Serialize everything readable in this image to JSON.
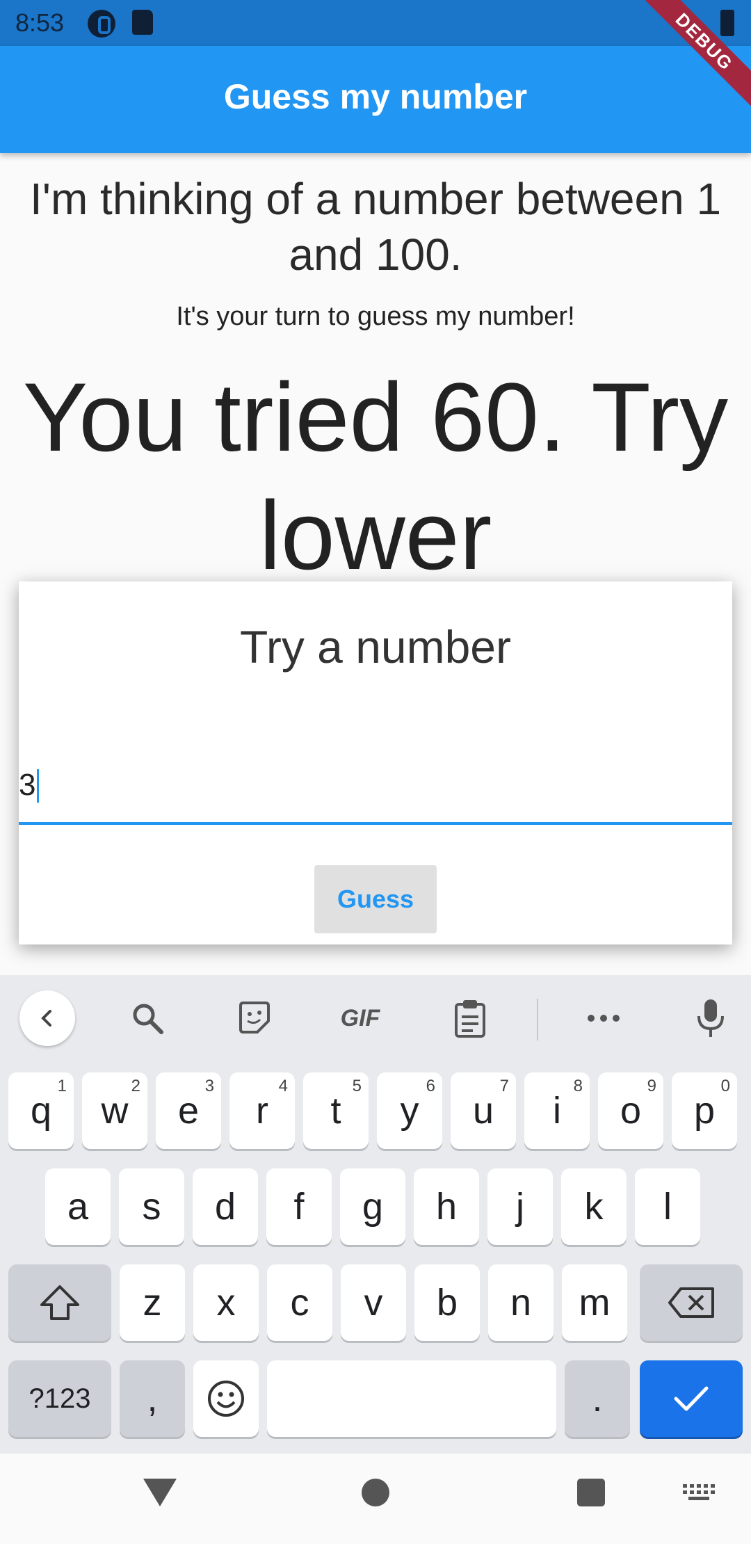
{
  "status_bar": {
    "time": "8:53"
  },
  "debug_banner": "DEBUG",
  "app_bar": {
    "title": "Guess my number"
  },
  "main": {
    "intro": "I'm thinking of a number between 1 and 100.",
    "subtitle": "It's your turn to guess my number!",
    "feedback": "You tried 60. Try lower"
  },
  "dialog": {
    "title": "Try a number",
    "input_value": "3",
    "button_label": "Guess"
  },
  "keyboard": {
    "toolbar": {
      "gif_label": "GIF"
    },
    "row1": [
      {
        "label": "q",
        "hint": "1"
      },
      {
        "label": "w",
        "hint": "2"
      },
      {
        "label": "e",
        "hint": "3"
      },
      {
        "label": "r",
        "hint": "4"
      },
      {
        "label": "t",
        "hint": "5"
      },
      {
        "label": "y",
        "hint": "6"
      },
      {
        "label": "u",
        "hint": "7"
      },
      {
        "label": "i",
        "hint": "8"
      },
      {
        "label": "o",
        "hint": "9"
      },
      {
        "label": "p",
        "hint": "0"
      }
    ],
    "row2": [
      "a",
      "s",
      "d",
      "f",
      "g",
      "h",
      "j",
      "k",
      "l"
    ],
    "row3": [
      "z",
      "x",
      "c",
      "v",
      "b",
      "n",
      "m"
    ],
    "symbols_label": "?123",
    "comma_label": ",",
    "period_label": "."
  }
}
